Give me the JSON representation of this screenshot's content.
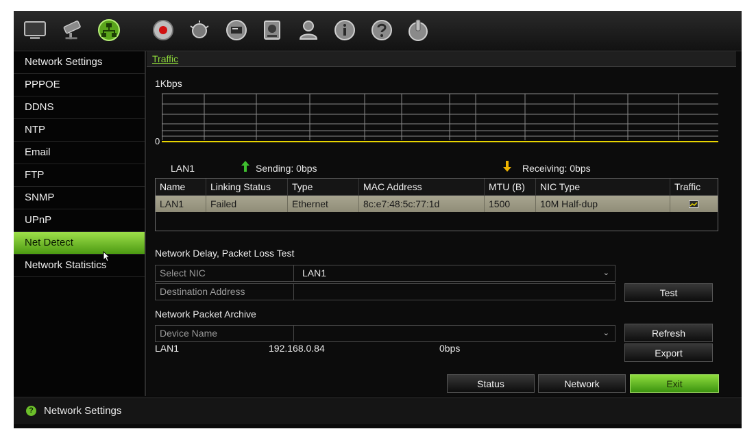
{
  "toolbar": {
    "icons": [
      "monitor-icon",
      "camera-icon",
      "network-icon",
      "record-icon",
      "alarm-icon",
      "device-icon",
      "hdd-icon",
      "user-icon",
      "info-icon",
      "help-icon",
      "power-icon"
    ]
  },
  "sidebar": {
    "items": [
      {
        "label": "Network Settings"
      },
      {
        "label": "PPPOE"
      },
      {
        "label": "DDNS"
      },
      {
        "label": "NTP"
      },
      {
        "label": "Email"
      },
      {
        "label": "FTP"
      },
      {
        "label": "SNMP"
      },
      {
        "label": "UPnP"
      },
      {
        "label": "Net Detect"
      },
      {
        "label": "Network Statistics"
      }
    ],
    "active": "Net Detect"
  },
  "main": {
    "tab": "Traffic",
    "graph": {
      "max_label": "1Kbps",
      "zero_label": "0",
      "nic": "LAN1",
      "sending": "Sending: 0bps",
      "receiving": "Receiving: 0bps"
    },
    "nic_table": {
      "headers": [
        "Name",
        "Linking Status",
        "Type",
        "MAC Address",
        "MTU (B)",
        "NIC Type",
        "Traffic"
      ],
      "rows": [
        {
          "name": "LAN1",
          "status": "Failed",
          "type": "Ethernet",
          "mac": "8c:e7:48:5c:77:1d",
          "mtu": "1500",
          "nic_type": "10M Half-dup"
        }
      ]
    },
    "delay_test": {
      "title": "Network Delay, Packet Loss Test",
      "select_nic_label": "Select NIC",
      "select_nic_value": "LAN1",
      "destination_label": "Destination Address",
      "destination_value": "",
      "test_button": "Test"
    },
    "archive": {
      "title": "Network Packet Archive",
      "device_label": "Device Name",
      "device_value": "",
      "refresh_button": "Refresh",
      "export_button": "Export",
      "info_nic": "LAN1",
      "info_ip": "192.168.0.84",
      "info_rate": "0bps"
    },
    "buttons": {
      "status": "Status",
      "network": "Network",
      "exit": "Exit"
    }
  },
  "statusbar": {
    "text": "Network Settings"
  },
  "colors": {
    "accent_green": "#6cbf2a",
    "selected_row": "#a09d88",
    "background": "#0a0a0a"
  }
}
